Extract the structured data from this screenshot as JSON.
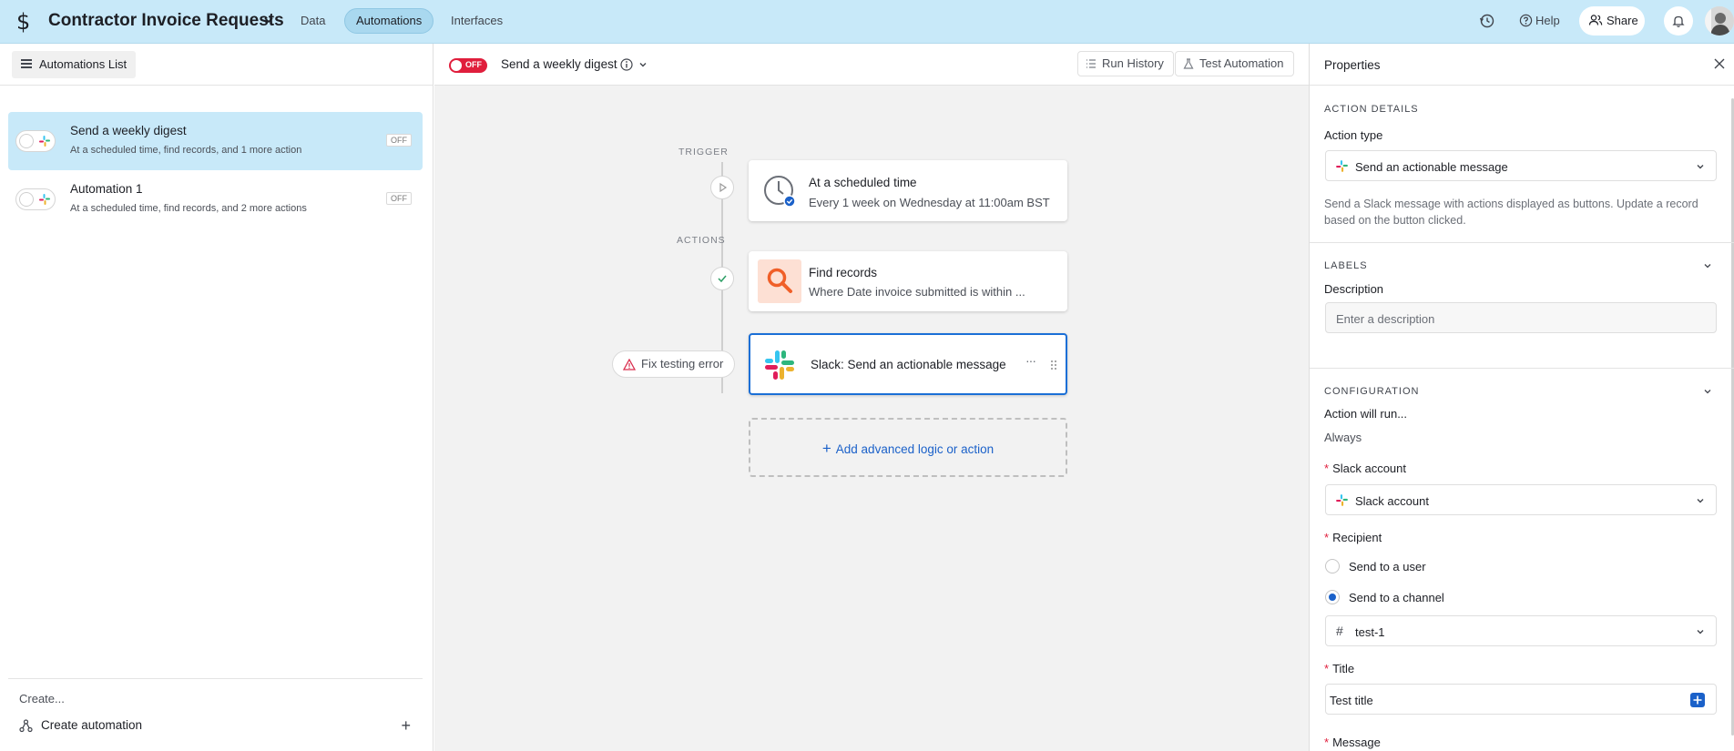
{
  "topbar": {
    "app_icon": "dollar-icon",
    "app_title": "Contractor Invoice Requests",
    "tabs": [
      "Data",
      "Automations",
      "Interfaces"
    ],
    "active_tab": "Automations",
    "help_label": "Help",
    "share_label": "Share",
    "accent_color": "#c8e9f9"
  },
  "left_panel": {
    "list_button_label": "Automations List",
    "automations": [
      {
        "title": "Send a weekly digest",
        "subtitle": "At a scheduled time, find records, and 1 more action",
        "status": "OFF",
        "selected": true
      },
      {
        "title": "Automation 1",
        "subtitle": "At a scheduled time, find records, and 2 more actions",
        "status": "OFF",
        "selected": false
      }
    ],
    "create_label": "Create...",
    "create_automation_label": "Create automation"
  },
  "center": {
    "toggle_label": "OFF",
    "automation_name": "Send a weekly digest",
    "run_history_label": "Run History",
    "test_automation_label": "Test Automation",
    "trigger_label": "TRIGGER",
    "actions_label": "ACTIONS",
    "trigger_card": {
      "title": "At a scheduled time",
      "subtitle": "Every 1 week on Wednesday at 11:00am BST"
    },
    "find_card": {
      "title": "Find records",
      "subtitle": "Where Date invoice submitted is within ..."
    },
    "slack_card": {
      "title": "Slack: Send an actionable message"
    },
    "fix_error_label": "Fix testing error",
    "add_logic_label": "Add advanced logic or action"
  },
  "properties": {
    "title": "Properties",
    "action_details_title": "ACTION DETAILS",
    "action_type_label": "Action type",
    "action_type_value": "Send an actionable message",
    "action_description": "Send a Slack message with actions displayed as buttons. Update a record based on the button clicked.",
    "labels_title": "LABELS",
    "description_label": "Description",
    "description_placeholder": "Enter a description",
    "configuration_title": "CONFIGURATION",
    "action_will_run_label": "Action will run...",
    "action_will_run_value": "Always",
    "slack_account_label": "Slack account",
    "slack_account_value": "Slack account",
    "recipient_label": "Recipient",
    "recipient_options": [
      "Send to a user",
      "Send to a channel"
    ],
    "recipient_selected": "Send to a channel",
    "channel_value": "test-1",
    "title_label": "Title",
    "title_value": "Test title",
    "message_label": "Message"
  }
}
